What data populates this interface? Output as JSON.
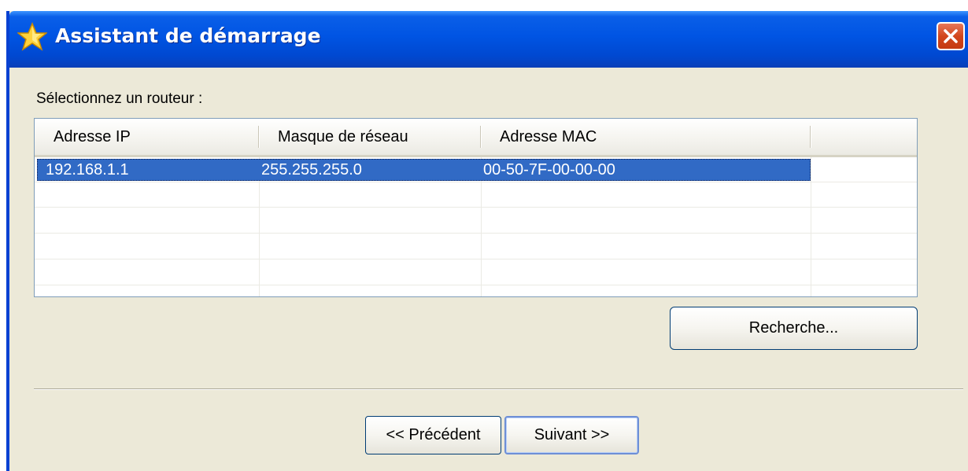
{
  "window": {
    "title": "Assistant de démarrage",
    "icon": "star-icon",
    "close_icon": "close-icon"
  },
  "prompt": "Sélectionnez un routeur :",
  "table": {
    "columns": [
      "Adresse IP",
      "Masque de réseau",
      "Adresse MAC"
    ],
    "rows": [
      {
        "ip": "192.168.1.1",
        "mask": "255.255.255.0",
        "mac": "00-50-7F-00-00-00",
        "selected": true
      }
    ]
  },
  "buttons": {
    "search": "Recherche...",
    "previous": "<< Précédent",
    "next": "Suivant >>"
  },
  "colors": {
    "titlebar": "#0054e3",
    "selection": "#316ac5",
    "dialog_background": "#ece9d8",
    "close_button": "#d2461c"
  }
}
